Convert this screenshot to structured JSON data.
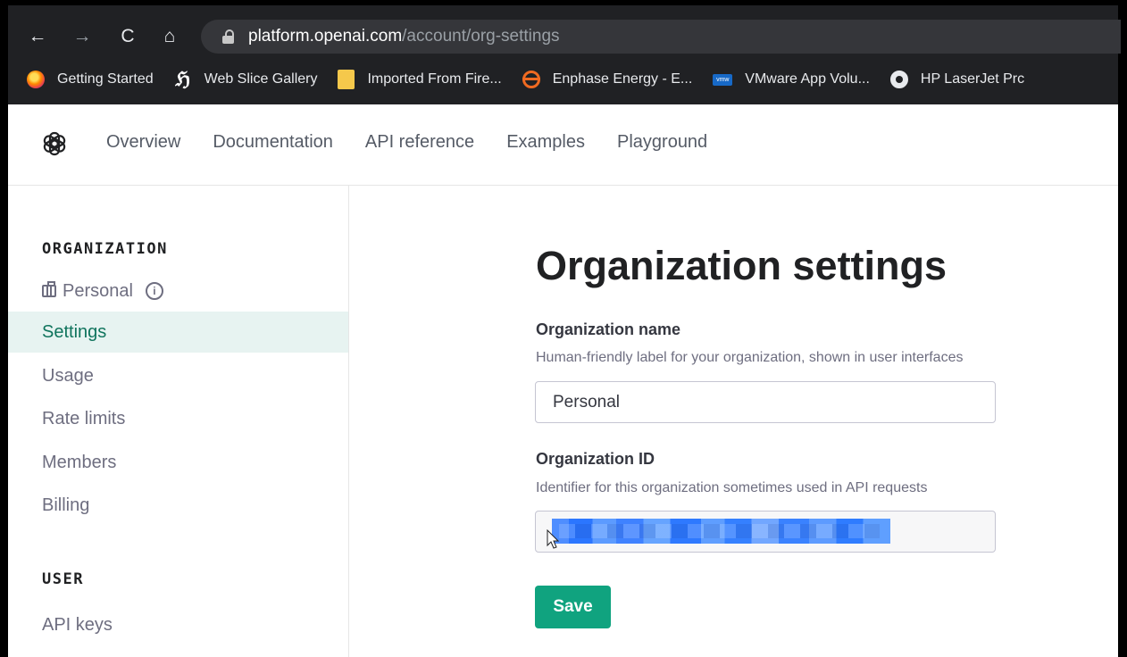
{
  "browser": {
    "url_host": "platform.openai.com",
    "url_path": "/account/org-settings",
    "nav": {
      "back_icon": "back-arrow-icon",
      "forward_icon": "forward-arrow-icon",
      "reload_icon": "reload-icon",
      "home_icon": "home-icon"
    },
    "bookmarks": [
      {
        "label": "Getting Started",
        "icon": "firefox-icon"
      },
      {
        "label": "Web Slice Gallery",
        "icon": "web-slice-icon"
      },
      {
        "label": "Imported From Fire...",
        "icon": "folder-icon"
      },
      {
        "label": "Enphase Energy - E...",
        "icon": "enphase-icon"
      },
      {
        "label": "VMware App Volu...",
        "icon": "vmware-icon"
      },
      {
        "label": "HP LaserJet Prc",
        "icon": "globe-icon"
      }
    ]
  },
  "site_header": {
    "logo_icon": "openai-logo-icon",
    "nav": [
      "Overview",
      "Documentation",
      "API reference",
      "Examples",
      "Playground"
    ]
  },
  "sidebar": {
    "organization_title": "ORGANIZATION",
    "current_org": "Personal",
    "items": [
      "Settings",
      "Usage",
      "Rate limits",
      "Members",
      "Billing"
    ],
    "active_item": "Settings",
    "user_title": "USER",
    "user_items": [
      "API keys"
    ]
  },
  "main": {
    "title": "Organization settings",
    "org_name": {
      "label": "Organization name",
      "help": "Human-friendly label for your organization, shown in user interfaces",
      "value": "Personal"
    },
    "org_id": {
      "label": "Organization ID",
      "help": "Identifier for this organization sometimes used in API requests"
    },
    "save_label": "Save"
  },
  "colors": {
    "accent": "#10a37f",
    "active_sidebar": "#e7f3f1",
    "browser_bg": "#202124"
  }
}
